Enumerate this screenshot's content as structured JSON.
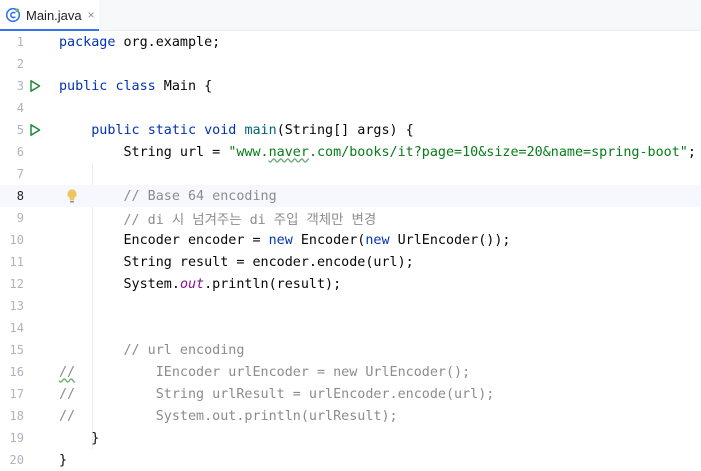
{
  "tab": {
    "filename": "Main.java",
    "close": "×"
  },
  "lines": [
    {
      "n": "1",
      "segs": [
        {
          "t": "package",
          "c": "kw"
        },
        {
          "t": " org.example;"
        }
      ]
    },
    {
      "n": "2",
      "segs": []
    },
    {
      "n": "3",
      "run": true,
      "segs": [
        {
          "t": "public",
          "c": "kw"
        },
        {
          "t": " "
        },
        {
          "t": "class",
          "c": "kw"
        },
        {
          "t": " Main {"
        }
      ]
    },
    {
      "n": "4",
      "segs": []
    },
    {
      "n": "5",
      "run": true,
      "segs": [
        {
          "t": "    "
        },
        {
          "t": "public",
          "c": "kw"
        },
        {
          "t": " "
        },
        {
          "t": "static",
          "c": "kw"
        },
        {
          "t": " "
        },
        {
          "t": "void",
          "c": "kw"
        },
        {
          "t": " "
        },
        {
          "t": "main",
          "c": "fn"
        },
        {
          "t": "(String[] args) {"
        }
      ]
    },
    {
      "n": "6",
      "segs": [
        {
          "t": "        String url = "
        },
        {
          "t": "\"www.",
          "c": "str"
        },
        {
          "t": "naver",
          "c": "str typo"
        },
        {
          "t": ".com/books/it?page=10&size=20&name=spring-boot\"",
          "c": "str"
        },
        {
          "t": ";"
        }
      ]
    },
    {
      "n": "7",
      "segs": []
    },
    {
      "n": "8",
      "current": true,
      "bulb": true,
      "segs": [
        {
          "t": "        "
        },
        {
          "t": "// Base 64 encoding",
          "c": "cm"
        }
      ]
    },
    {
      "n": "9",
      "segs": [
        {
          "t": "        "
        },
        {
          "t": "// di 시 넘겨주는 di 주입 객체만 변경",
          "c": "cm"
        }
      ]
    },
    {
      "n": "10",
      "segs": [
        {
          "t": "        Encoder encoder = "
        },
        {
          "t": "new",
          "c": "kw"
        },
        {
          "t": " Encoder("
        },
        {
          "t": "new",
          "c": "kw"
        },
        {
          "t": " UrlEncoder());"
        }
      ]
    },
    {
      "n": "11",
      "segs": [
        {
          "t": "        String result = encoder.encode(url);"
        }
      ]
    },
    {
      "n": "12",
      "segs": [
        {
          "t": "        System."
        },
        {
          "t": "out",
          "c": "st"
        },
        {
          "t": ".println(result);"
        }
      ]
    },
    {
      "n": "13",
      "segs": []
    },
    {
      "n": "14",
      "segs": []
    },
    {
      "n": "15",
      "segs": [
        {
          "t": "        "
        },
        {
          "t": "// url encoding",
          "c": "cm"
        }
      ]
    },
    {
      "n": "16",
      "segs": [
        {
          "t": "//",
          "c": "cm typo"
        },
        {
          "t": "          IEncoder urlEncoder = new UrlEncoder();",
          "c": "cm"
        }
      ]
    },
    {
      "n": "17",
      "segs": [
        {
          "t": "//          String urlResult = urlEncoder.encode(url);",
          "c": "cm"
        }
      ]
    },
    {
      "n": "18",
      "segs": [
        {
          "t": "//          System.out.println(urlResult);",
          "c": "cm"
        }
      ]
    },
    {
      "n": "19",
      "segs": [
        {
          "t": "    }"
        }
      ]
    },
    {
      "n": "20",
      "segs": [
        {
          "t": "}"
        }
      ]
    }
  ]
}
